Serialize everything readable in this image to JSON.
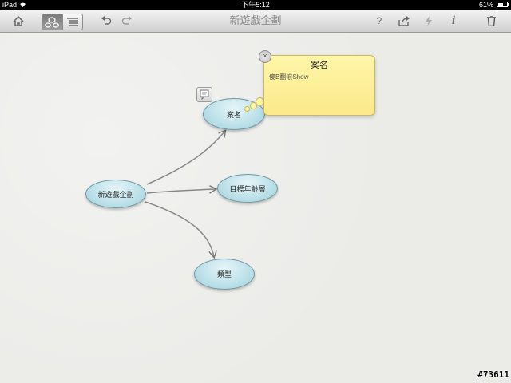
{
  "status_bar": {
    "device": "iPad",
    "time": "下午5:12",
    "battery": "61%",
    "battery_level": 0.61
  },
  "toolbar": {
    "title": "新遊戲企劃",
    "home_icon": "home-icon",
    "mindmap_view_icon": "mindmap-view-icon",
    "outline_view_icon": "outline-view-icon",
    "undo_icon": "undo-icon",
    "redo_icon": "redo-icon",
    "help_label": "?",
    "share_icon": "share-icon",
    "bolt_icon": "lightning-icon",
    "info_label": "i",
    "trash_icon": "trash-icon"
  },
  "mindmap": {
    "root": "新遊戲企劃",
    "children": [
      {
        "label": "案名"
      },
      {
        "label": "目標年齡層"
      },
      {
        "label": "類型"
      }
    ]
  },
  "note": {
    "title": "案名",
    "body": "傻B翻滾Show",
    "close_label": "×"
  },
  "watermark": "#73611"
}
